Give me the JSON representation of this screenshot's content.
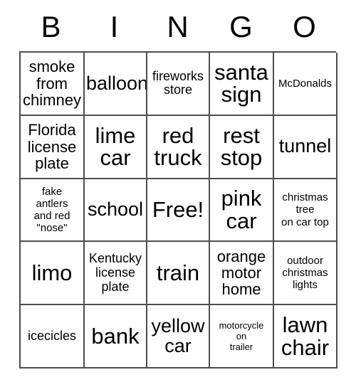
{
  "card": {
    "title": "BINGO",
    "header_letters": [
      "B",
      "I",
      "N",
      "G",
      "O"
    ],
    "free_space_label": "Free!",
    "colors": {
      "background": "#ffffff",
      "text": "#000000",
      "grid_line": "#4d4d4d"
    },
    "rows": [
      [
        {
          "text": "smoke\nfrom\nchimney",
          "size": "fs-lg"
        },
        {
          "text": "balloon",
          "size": "fs-xl"
        },
        {
          "text": "fireworks\nstore",
          "size": "fs-md"
        },
        {
          "text": "santa\nsign",
          "size": "fs-xxl"
        },
        {
          "text": "McDonalds",
          "size": "fs-sm"
        }
      ],
      [
        {
          "text": "Florida\nlicense\nplate",
          "size": "fs-lg"
        },
        {
          "text": "lime\ncar",
          "size": "fs-xxl"
        },
        {
          "text": "red\ntruck",
          "size": "fs-xxl"
        },
        {
          "text": "rest\nstop",
          "size": "fs-xxl"
        },
        {
          "text": "tunnel",
          "size": "fs-xl"
        }
      ],
      [
        {
          "text": "fake\nantlers\nand red\n\"nose\"",
          "size": "fs-sm"
        },
        {
          "text": "school",
          "size": "fs-xl"
        },
        {
          "text": "Free!",
          "size": "fs-xxl"
        },
        {
          "text": "pink\ncar",
          "size": "fs-xxl"
        },
        {
          "text": "christmas\ntree\non car top",
          "size": "fs-sm"
        }
      ],
      [
        {
          "text": "limo",
          "size": "fs-xxl"
        },
        {
          "text": "Kentucky\nlicense\nplate",
          "size": "fs-md"
        },
        {
          "text": "train",
          "size": "fs-xxl"
        },
        {
          "text": "orange\nmotor\nhome",
          "size": "fs-lg"
        },
        {
          "text": "outdoor\nchristmas\nlights",
          "size": "fs-sm"
        }
      ],
      [
        {
          "text": "icecicles",
          "size": "fs-md"
        },
        {
          "text": "bank",
          "size": "fs-xxl"
        },
        {
          "text": "yellow\ncar",
          "size": "fs-xl"
        },
        {
          "text": "motorcycle\non\ntrailer",
          "size": "fs-xs"
        },
        {
          "text": "lawn\nchair",
          "size": "fs-xxl"
        }
      ]
    ]
  }
}
